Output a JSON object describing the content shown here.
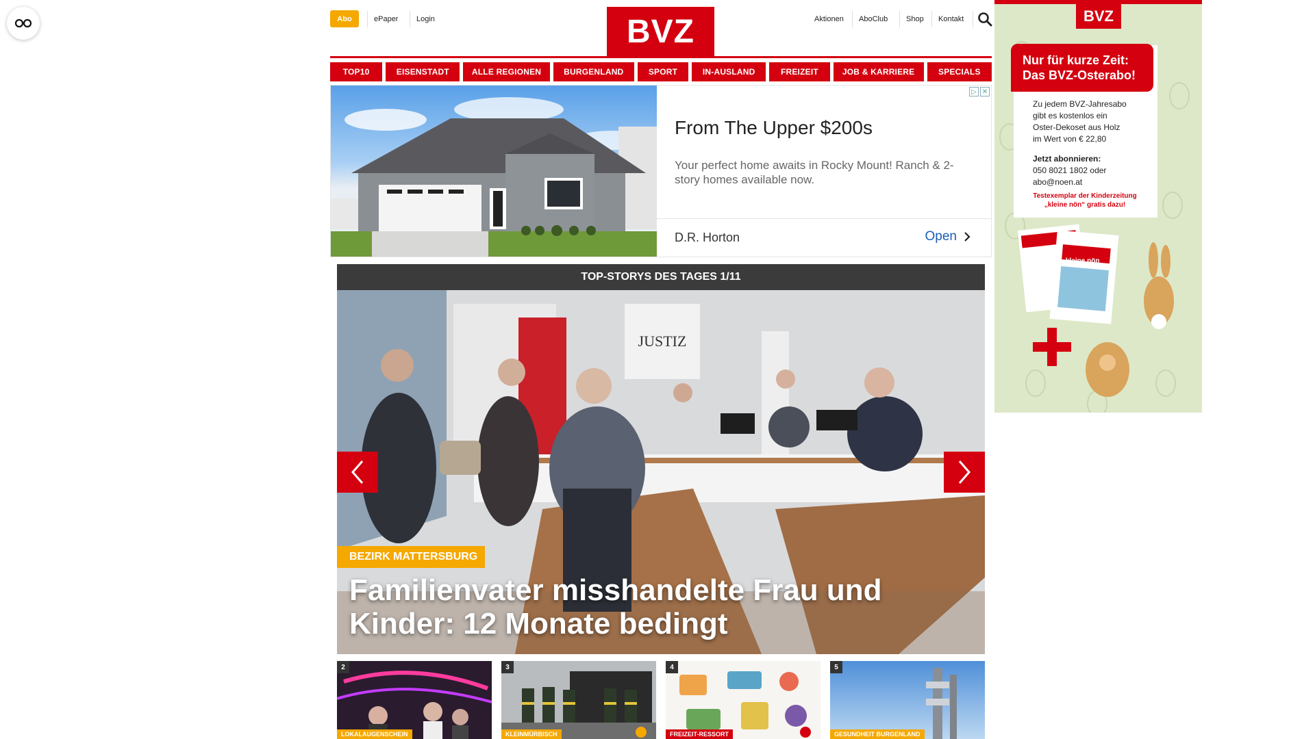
{
  "accessibility": {
    "icon": "glasses-icon"
  },
  "header": {
    "abo": "Abo",
    "links_left": [
      "ePaper",
      "Login"
    ],
    "logo": "BVZ",
    "links_right": [
      "Aktionen",
      "AboClub",
      "Shop",
      "Kontakt"
    ],
    "search_icon": "search-icon"
  },
  "nav": {
    "items": [
      "TOP10",
      "EISENSTADT",
      "ALLE REGIONEN",
      "BURGENLAND",
      "SPORT",
      "IN-AUSLAND",
      "FREIZEIT",
      "JOB & KARRIERE",
      "SPECIALS"
    ]
  },
  "ad": {
    "headline": "From The Upper $200s",
    "body": "Your perfect home awaits in Rocky Mount! Ranch & 2-story homes available now.",
    "advertiser": "D.R. Horton",
    "cta": "Open"
  },
  "top_stories": {
    "bar_title": "TOP-STORYS DES TAGES 1/11",
    "sign_text": "JUSTIZ",
    "category": "BEZIRK MATTERSBURG",
    "headline": "Familienvater misshandelte Frau und Kinder: 12 Monate bedingt"
  },
  "thumbnails": [
    {
      "num": "2",
      "category": "LOKALAUGENSCHEIN"
    },
    {
      "num": "3",
      "category": "KLEINMÜRBISCH"
    },
    {
      "num": "4",
      "category": "FREIZEIT-RESSORT"
    },
    {
      "num": "5",
      "category": "GESUNDHEIT BURGENLAND"
    }
  ],
  "sidebar_ad": {
    "logo": "BVZ",
    "headline_line1": "Nur für kurze Zeit:",
    "headline_line2": "Das BVZ-Osterabo!",
    "text_lines": [
      "Zu jedem BVZ-Jahresabo",
      "gibt es kostenlos ein",
      "Oster-Dekoset aus Holz",
      "im Wert von € 22,80"
    ],
    "cta_title": "Jetzt abonnieren:",
    "cta_lines": [
      "050 8021 1802 oder",
      "abo@noen.at"
    ],
    "sub_line1": "Testexemplar der Kinderzeitung",
    "sub_line2": "„kleine nön“ gratis dazu!",
    "newspaper_labels": [
      "BVZ",
      "kleine nön"
    ]
  },
  "colors": {
    "brand_red": "#d4000f",
    "accent_orange": "#f5a800",
    "dark_bar": "#3b3b3b",
    "link_blue": "#1a5fb4"
  }
}
